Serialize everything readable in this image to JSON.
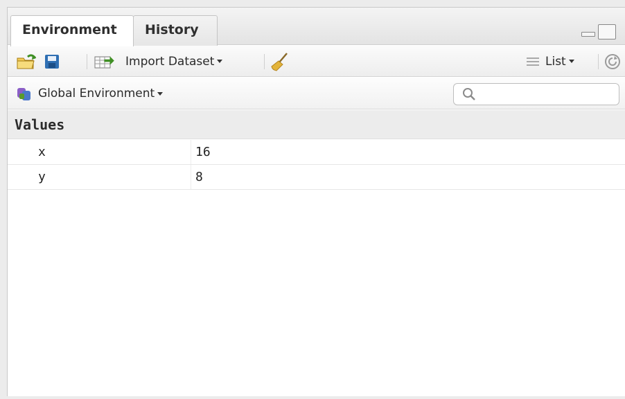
{
  "tabs": [
    {
      "label": "Environment",
      "active": true
    },
    {
      "label": "History",
      "active": false
    }
  ],
  "toolbar": {
    "import_label": "Import Dataset",
    "view_label": "List",
    "icons": [
      "open-folder-icon",
      "save-icon",
      "import-dataset-icon",
      "broom-icon",
      "list-view-icon",
      "refresh-icon"
    ]
  },
  "environment": {
    "selected": "Global Environment"
  },
  "search": {
    "placeholder": ""
  },
  "values_section": {
    "title": "Values",
    "rows": [
      {
        "name": "x",
        "value": "16"
      },
      {
        "name": "y",
        "value": "8"
      }
    ]
  },
  "colors": {
    "accent_green": "#5a9a2a",
    "save_blue": "#2f6fb3",
    "env_purple": "#8b5fc7",
    "env_blue": "#4a78c9",
    "broom_yellow": "#e3b43a"
  }
}
